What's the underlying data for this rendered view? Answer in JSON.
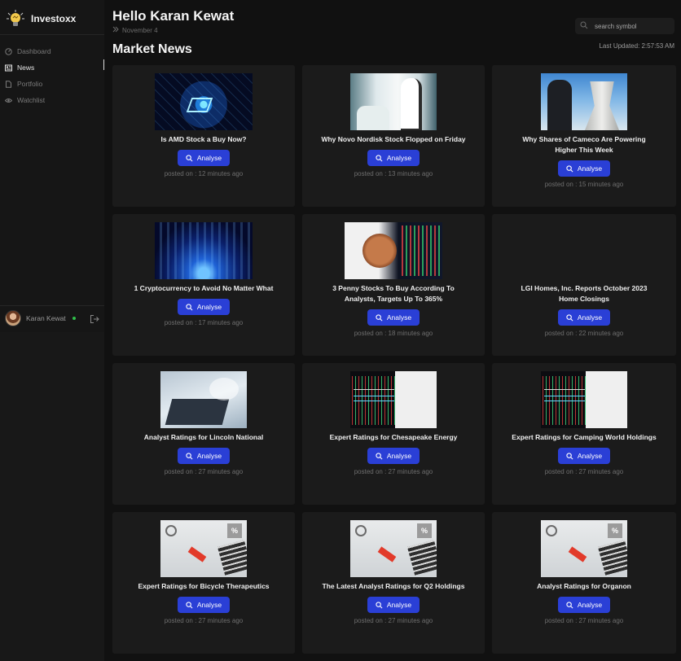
{
  "app": {
    "name": "Investoxx"
  },
  "sidebar": {
    "items": [
      {
        "label": "Dashboard",
        "icon": "dashboard-icon",
        "active": false
      },
      {
        "label": "News",
        "icon": "news-icon",
        "active": true
      },
      {
        "label": "Portfolio",
        "icon": "portfolio-icon",
        "active": false
      },
      {
        "label": "Watchlist",
        "icon": "eye-icon",
        "active": false
      }
    ],
    "user": {
      "name": "Karan Kewat",
      "status": "online"
    }
  },
  "header": {
    "greeting": "Hello Karan Kewat",
    "date": "November 4",
    "title": "Market News",
    "last_updated": "Last Updated: 2:57:53 AM"
  },
  "search": {
    "placeholder": "search symbol",
    "value": ""
  },
  "colors": {
    "accent": "#2a3fd6",
    "background": "#111111",
    "card": "#1b1b1b",
    "online": "#2fbf4a"
  },
  "news": {
    "button_label": "Analyse",
    "items": [
      {
        "title": "Is AMD Stock a Buy Now?",
        "posted": "posted on : 12 minutes ago",
        "image": "chip-image"
      },
      {
        "title": "Why Novo Nordisk Stock Flopped on Friday",
        "posted": "posted on : 13 minutes ago",
        "image": "lab-image"
      },
      {
        "title": "Why Shares of Cameco Are Powering Higher This Week",
        "posted": "posted on : 15 minutes ago",
        "image": "nuclear-plant-image"
      },
      {
        "title": "1 Cryptocurrency to Avoid No Matter What",
        "posted": "posted on : 17 minutes ago",
        "image": "crypto-image"
      },
      {
        "title": "3 Penny Stocks To Buy According To Analysts, Targets Up To 365%",
        "posted": "posted on : 18 minutes ago",
        "image": "penny-chart-image"
      },
      {
        "title": "LGI Homes, Inc. Reports October 2023 Home Closings",
        "posted": "posted on : 22 minutes ago",
        "image": ""
      },
      {
        "title": "Analyst Ratings for Lincoln National",
        "posted": "posted on : 27 minutes ago",
        "image": "laptop-image"
      },
      {
        "title": "Expert Ratings for Chesapeake Energy",
        "posted": "posted on : 27 minutes ago",
        "image": "stock-chart-image"
      },
      {
        "title": "Expert Ratings for Camping World Holdings",
        "posted": "posted on : 27 minutes ago",
        "image": "stock-chart-image"
      },
      {
        "title": "Expert Ratings for Bicycle Therapeutics",
        "posted": "posted on : 27 minutes ago",
        "image": "desk-percent-image"
      },
      {
        "title": "The Latest Analyst Ratings for Q2 Holdings",
        "posted": "posted on : 27 minutes ago",
        "image": "desk-percent-image"
      },
      {
        "title": "Analyst Ratings for Organon",
        "posted": "posted on : 27 minutes ago",
        "image": "desk-percent-image"
      }
    ]
  }
}
